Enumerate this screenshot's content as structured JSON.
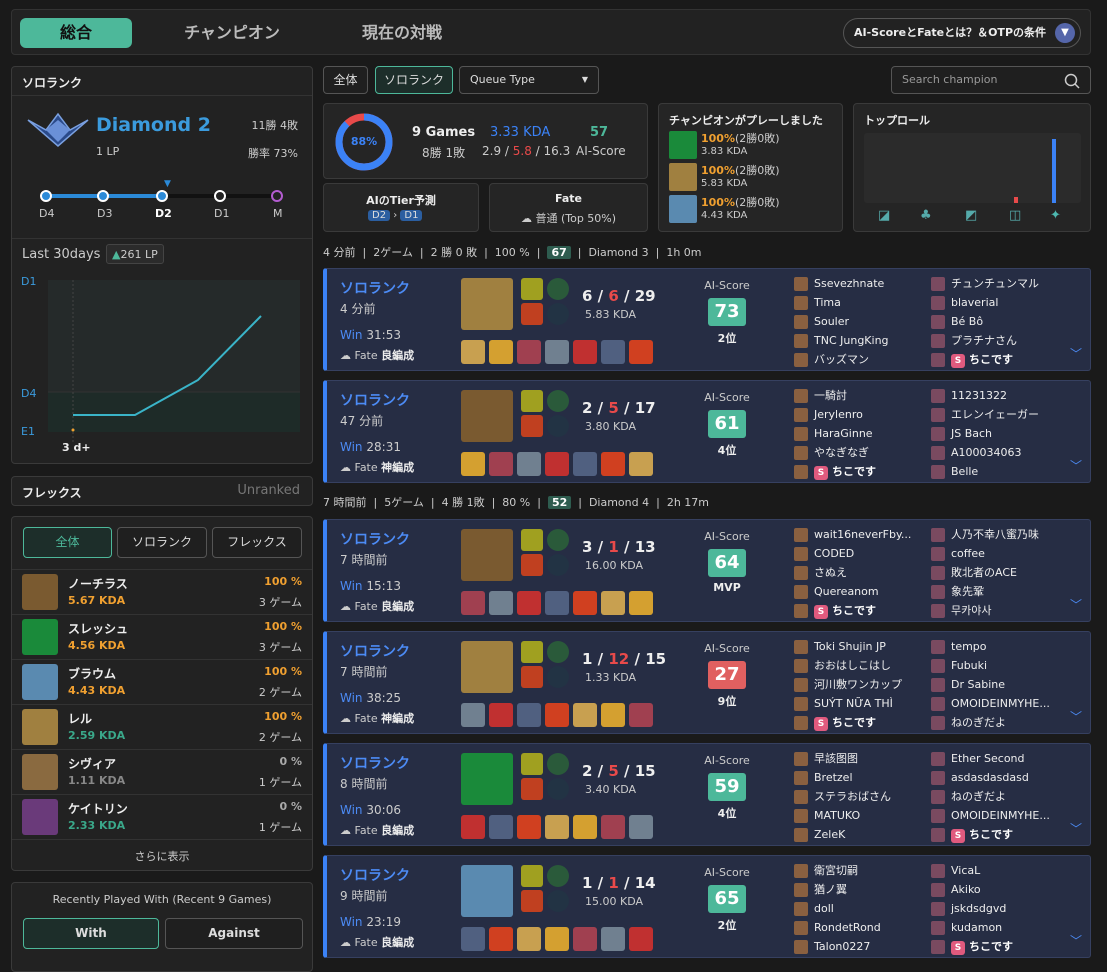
{
  "nav": {
    "tabs": [
      "総合",
      "チャンピオン",
      "現在の対戦"
    ],
    "help": "AI-ScoreとFateとは？＆OTPの条件"
  },
  "rank": {
    "title": "ソロランク",
    "tier": "Diamond 2",
    "lp": "1 LP",
    "record": "11勝 4敗",
    "winrate": "勝率 73%",
    "ladder": [
      "D4",
      "D3",
      "D2",
      "D1",
      "M"
    ],
    "chart_title": "Last 30days",
    "chart_delta": "261 LP",
    "chart_data": {
      "type": "line",
      "ylabels": [
        "D1",
        "D4",
        "E1"
      ],
      "xlabel": "3 d+"
    }
  },
  "flex": {
    "title": "フレックス",
    "status": "Unranked"
  },
  "champ_filter": [
    "全体",
    "ソロランク",
    "フレックス"
  ],
  "champions": [
    {
      "name": "ノーチラス",
      "kda": "5.67 KDA",
      "wr": "100",
      "games": "3 ゲーム",
      "kda_color": "#f0a030",
      "wr_color": "#f0a030",
      "color": "#7a5a30"
    },
    {
      "name": "スレッシュ",
      "kda": "4.56 KDA",
      "wr": "100",
      "games": "3 ゲーム",
      "kda_color": "#f0a030",
      "wr_color": "#f0a030",
      "color": "#1a8a3a"
    },
    {
      "name": "ブラウム",
      "kda": "4.43 KDA",
      "wr": "100",
      "games": "2 ゲーム",
      "kda_color": "#f0a030",
      "wr_color": "#f0a030",
      "color": "#5a8ab0"
    },
    {
      "name": "レル",
      "kda": "2.59 KDA",
      "wr": "100",
      "games": "2 ゲーム",
      "kda_color": "#3aa88a",
      "wr_color": "#f0a030",
      "color": "#a08040"
    },
    {
      "name": "シヴィア",
      "kda": "1.11 KDA",
      "wr": "0",
      "games": "1 ゲーム",
      "kda_color": "#888",
      "wr_color": "#aaa",
      "color": "#8a6a40"
    },
    {
      "name": "ケイトリン",
      "kda": "2.33 KDA",
      "wr": "0",
      "games": "1 ゲーム",
      "kda_color": "#3aa88a",
      "wr_color": "#aaa",
      "color": "#6a3a7a"
    }
  ],
  "more": "さらに表示",
  "recent": {
    "title": "Recently Played With (Recent 9 Games)",
    "with": "With",
    "against": "Against"
  },
  "filters": {
    "all": "全体",
    "solo": "ソロランク",
    "queue": "Queue Type",
    "search_placeholder": "Search champion"
  },
  "summary": {
    "pct": "88%",
    "games": "9 Games",
    "record": "8勝 1敗",
    "kda": "3.33 KDA",
    "kda_k": "2.9",
    "kda_d": "5.8",
    "kda_a": "16.3",
    "ai": "57",
    "ai_label": "AI-Score",
    "tier_title": "AIのTier予測",
    "tier_from": "D2",
    "tier_to": "D1",
    "fate_title": "Fate",
    "fate_value": "普通 (Top 50%)",
    "played_title": "チャンピオンがプレーしました",
    "played": [
      {
        "wr": "100%",
        "rec": "(2勝0敗)",
        "kda": "3.83 KDA",
        "color": "#1a8a3a"
      },
      {
        "wr": "100%",
        "rec": "(2勝0敗)",
        "kda": "5.83 KDA",
        "color": "#a08040"
      },
      {
        "wr": "100%",
        "rec": "(2勝0敗)",
        "kda": "4.43 KDA",
        "color": "#5a8ab0"
      }
    ],
    "role_title": "トップロール"
  },
  "sessions": [
    {
      "ago": "4 分前",
      "games": "2ゲーム",
      "rec": "2 勝 0 敗",
      "wr": "100 %",
      "score": "67",
      "tier": "Diamond 3",
      "dur": "1h 0m"
    },
    {
      "ago": "7 時間前",
      "games": "5ゲーム",
      "rec": "4 勝 1敗",
      "wr": "80 %",
      "score": "52",
      "tier": "Diamond 4",
      "dur": "2h 17m"
    }
  ],
  "matches": [
    {
      "queue": "ソロランク",
      "ago": "4 分前",
      "res": "Win",
      "time": "31:53",
      "fate": "Fate",
      "fate_v": "良編成",
      "k": "6",
      "d": "6",
      "a": "29",
      "kda": "5.83 KDA",
      "ai": "73",
      "rank": "2位",
      "ai_color": "#4db89a",
      "champ_color": "#a08040",
      "blue": [
        "Ssevezhnate",
        "Tima",
        "Souler",
        "TNC JungKing",
        "バッズマン"
      ],
      "red": [
        "チュンチュンマル",
        "blaverial",
        "Bé Bô",
        "プラチナさん",
        "ちこです"
      ],
      "red_me": 4
    },
    {
      "queue": "ソロランク",
      "ago": "47 分前",
      "res": "Win",
      "time": "28:31",
      "fate": "Fate",
      "fate_v": "神編成",
      "k": "2",
      "d": "5",
      "a": "17",
      "kda": "3.80 KDA",
      "ai": "61",
      "rank": "4位",
      "ai_color": "#4db89a",
      "champ_color": "#7a5a30",
      "blue": [
        "一騎討",
        "Jerylenro",
        "HaraGinne",
        "やなぎなぎ",
        "ちこです"
      ],
      "red": [
        "11231322",
        "エレンイェーガー",
        "JS Bach",
        "A100034063",
        "Belle"
      ],
      "blue_me": 4
    },
    {
      "queue": "ソロランク",
      "ago": "7 時間前",
      "res": "Win",
      "time": "15:13",
      "fate": "Fate",
      "fate_v": "良編成",
      "k": "3",
      "d": "1",
      "a": "13",
      "kda": "16.00 KDA",
      "ai": "64",
      "rank": "MVP",
      "ai_color": "#4db89a",
      "champ_color": "#7a5a30",
      "blue": [
        "wait16neverFby...",
        "CODED",
        "さぬえ",
        "Quereanom",
        "ちこです"
      ],
      "red": [
        "人乃不幸八蜜乃味",
        "coffee",
        "敗北者のACE",
        "象先鞏",
        "무카야사"
      ],
      "blue_me": 4
    },
    {
      "queue": "ソロランク",
      "ago": "7 時間前",
      "res": "Win",
      "time": "38:25",
      "fate": "Fate",
      "fate_v": "神編成",
      "k": "1",
      "d": "12",
      "a": "15",
      "kda": "1.33 KDA",
      "ai": "27",
      "rank": "9位",
      "ai_color": "#e06060",
      "champ_color": "#a08040",
      "blue": [
        "Toki Shujin JP",
        "おおはしこはし",
        "河川敷ワンカップ",
        "SUÝT NỮA THÌ",
        "ちこです"
      ],
      "red": [
        "tempo",
        "Fubuki",
        "Dr Sabine",
        "OMOIDEINMYHE...",
        "ねのぎだよ"
      ],
      "blue_me": 4
    },
    {
      "queue": "ソロランク",
      "ago": "8 時間前",
      "res": "Win",
      "time": "30:06",
      "fate": "Fate",
      "fate_v": "良編成",
      "k": "2",
      "d": "5",
      "a": "15",
      "kda": "3.40 KDA",
      "ai": "59",
      "rank": "4位",
      "ai_color": "#4db89a",
      "champ_color": "#1a8a3a",
      "blue": [
        "早該图图",
        "Bretzel",
        "ステラおばさん",
        "MATUKO",
        "ZeleK"
      ],
      "red": [
        "Ether Second",
        "asdasdasdasd",
        "ねのぎだよ",
        "OMOIDEINMYHE...",
        "ちこです"
      ],
      "red_me": 4
    },
    {
      "queue": "ソロランク",
      "ago": "9 時間前",
      "res": "Win",
      "time": "23:19",
      "fate": "Fate",
      "fate_v": "良編成",
      "k": "1",
      "d": "1",
      "a": "14",
      "kda": "15.00 KDA",
      "ai": "65",
      "rank": "2位",
      "ai_color": "#4db89a",
      "champ_color": "#5a8ab0",
      "blue": [
        "衛宮切嗣",
        "猶ノ翼",
        "doll",
        "RondetRond",
        "Talon0227"
      ],
      "red": [
        "VicaL",
        "Akiko",
        "jskdsdgvd",
        "kudamon",
        "ちこです"
      ],
      "red_me": 4
    }
  ]
}
